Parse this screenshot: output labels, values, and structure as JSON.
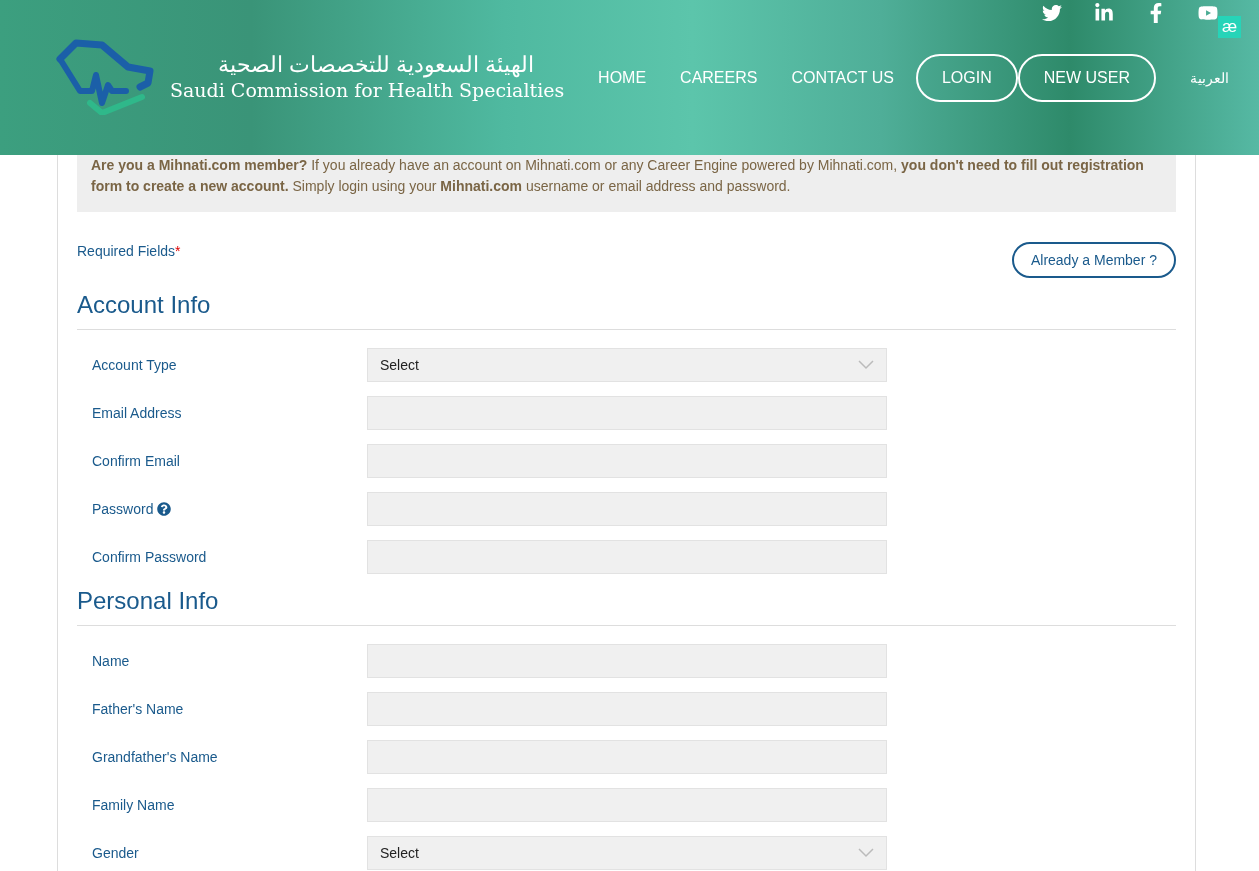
{
  "header": {
    "logo": {
      "arabic": "الهيئة السعودية للتخصصات الصحية",
      "english": "Saudi Commission for Health Specialties"
    },
    "social": [
      {
        "kind": "twitter"
      },
      {
        "kind": "linkedin"
      },
      {
        "kind": "facebook"
      },
      {
        "kind": "youtube"
      }
    ],
    "extension_badge": "æ",
    "nav": [
      {
        "label": "HOME",
        "kind": "link"
      },
      {
        "label": "CAREERS",
        "kind": "link"
      },
      {
        "label": "CONTACT US",
        "kind": "link"
      },
      {
        "label": "LOGIN",
        "kind": "pill"
      },
      {
        "label": "NEW USER",
        "kind": "pill"
      },
      {
        "label": "العربية",
        "kind": "lang"
      }
    ]
  },
  "notice": "**Are you a Mihnati.com member?** If you already have an account on Mihnati.com or any Career Engine powered by Mihnati.com, **you don't need to fill out registration form to create a new account.** Simply login using your **Mihnati.com** username or email address and password.",
  "required": {
    "label": "Required Fields",
    "mark": "*"
  },
  "member_button": "Already a Member ?",
  "sections": [
    {
      "title": "Account Info",
      "fields": [
        {
          "label": "Account Type",
          "kind": "select",
          "value": "Select"
        },
        {
          "label": "Email Address",
          "kind": "text"
        },
        {
          "label": "Confirm Email",
          "kind": "text"
        },
        {
          "label": "Password",
          "kind": "text",
          "help": true
        },
        {
          "label": "Confirm Password",
          "kind": "text"
        }
      ]
    },
    {
      "title": "Personal Info",
      "fields": [
        {
          "label": "Name",
          "kind": "text"
        },
        {
          "label": "Father's Name",
          "kind": "text"
        },
        {
          "label": "Grandfather's Name",
          "kind": "text"
        },
        {
          "label": "Family Name",
          "kind": "text"
        },
        {
          "label": "Gender",
          "kind": "select",
          "value": "Select"
        }
      ]
    }
  ]
}
